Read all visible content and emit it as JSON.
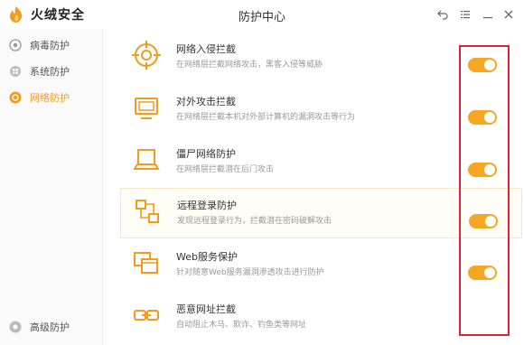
{
  "app": {
    "name": "火绒安全",
    "window_title": "防护中心"
  },
  "colors": {
    "accent": "#f5a623",
    "highlight_box": "#d9243a"
  },
  "window_controls": [
    {
      "icon": "back-icon"
    },
    {
      "icon": "menu-icon"
    },
    {
      "icon": "minimize-icon"
    },
    {
      "icon": "close-icon"
    }
  ],
  "sidebar": {
    "items": [
      {
        "label": "病毒防护",
        "icon": "virus-shield-icon",
        "active": false
      },
      {
        "label": "系统防护",
        "icon": "system-shield-icon",
        "active": false
      },
      {
        "label": "网络防护",
        "icon": "network-shield-icon",
        "active": true
      }
    ],
    "advanced": {
      "label": "高级防护",
      "icon": "advanced-shield-icon"
    }
  },
  "protections": [
    {
      "title": "网络入侵拦截",
      "desc": "在网络层拦截网络攻击，黑客入侵等威胁",
      "icon": "target-icon",
      "enabled": true
    },
    {
      "title": "对外攻击拦截",
      "desc": "在网络层拦截本机对外部计算机的漏洞攻击等行为",
      "icon": "monitor-icon",
      "enabled": true
    },
    {
      "title": "僵尸网络防护",
      "desc": "在网络层拦截潜在后门攻击",
      "icon": "laptop-icon",
      "enabled": true
    },
    {
      "title": "远程登录防护",
      "desc": "发现远程登录行为，拦截潜在密码破解攻击",
      "icon": "remote-login-icon",
      "enabled": true
    },
    {
      "title": "Web服务保护",
      "desc": "针对随意Web服务漏洞渗透攻击进行防护",
      "icon": "web-service-icon",
      "enabled": true
    },
    {
      "title": "恶意网址拦截",
      "desc": "自动阻止木马、欺诈、钓鱼类等网址",
      "icon": "link-icon",
      "enabled": true
    }
  ]
}
